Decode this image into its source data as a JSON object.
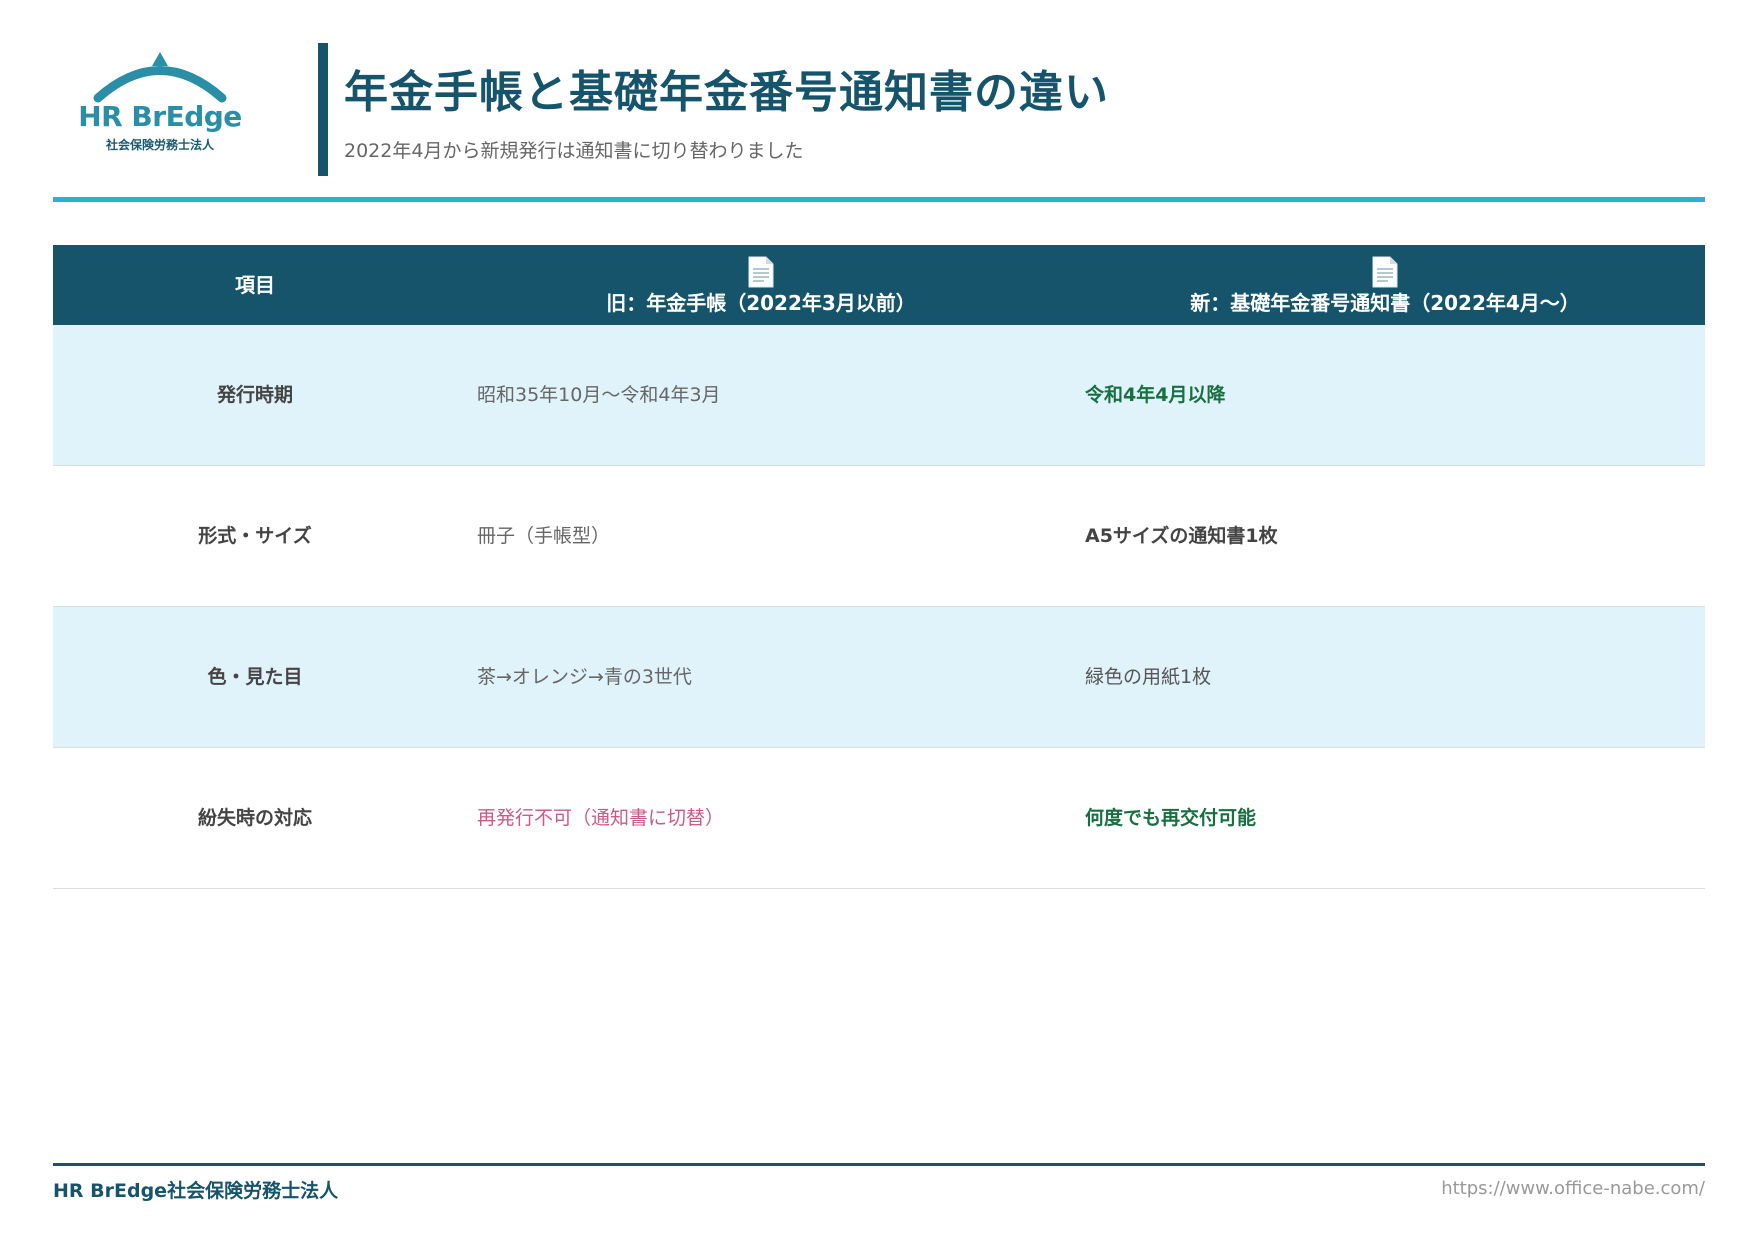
{
  "logo": {
    "name": "HR BrEdge",
    "sub": "社会保険労務士法人"
  },
  "header": {
    "title": "年金手帳と基礎年金番号通知書の違い",
    "subtitle": "2022年4月から新規発行は通知書に切り替わりました"
  },
  "table": {
    "headers": [
      {
        "label": "項目"
      },
      {
        "label": "旧：年金手帳（2022年3月以前）",
        "icon": "document-icon"
      },
      {
        "label": "新：基礎年金番号通知書（2022年4月～）",
        "icon": "document-icon"
      }
    ],
    "rows": [
      {
        "item": "発行時期",
        "old": "昭和35年10月～令和4年3月",
        "new": "令和4年4月以降"
      },
      {
        "item": "形式・サイズ",
        "old": "冊子（手帳型）",
        "new": "A5サイズの通知書1枚"
      },
      {
        "item": "色・見た目",
        "old": "茶→オレンジ→青の3世代",
        "new": "緑色の用紙1枚"
      },
      {
        "item": "紛失時の対応",
        "old": "再発行不可（通知書に切替）",
        "new": "何度でも再交付可能"
      }
    ]
  },
  "footer": {
    "company": "HR BrEdge社会保険労務士法人",
    "url": "https://www.office-nabe.com/"
  },
  "colors": {
    "primary": "#15546a",
    "accent": "#2ab0d4",
    "row_alt": "#e0f3fa",
    "positive": "#187040",
    "negative": "#cc5a86"
  }
}
